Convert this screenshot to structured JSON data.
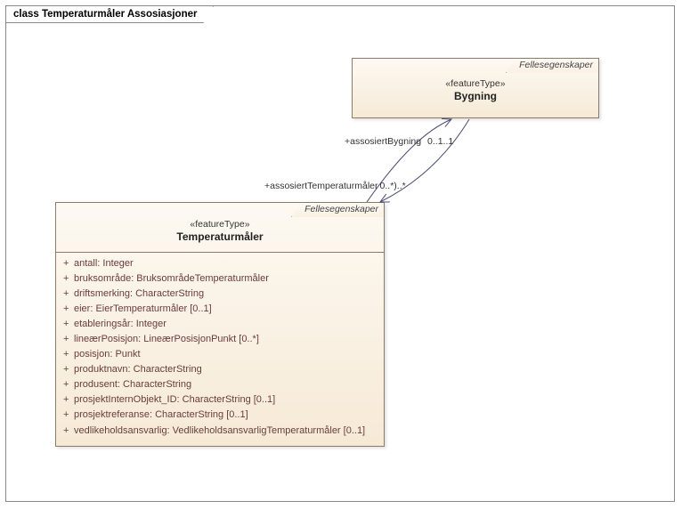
{
  "frame": {
    "title": "class Temperaturmåler Assosiasjoner"
  },
  "bygning": {
    "package": "Fellesegenskaper",
    "stereotype": "«featureType»",
    "name": "Bygning"
  },
  "temperaturmaler": {
    "package": "Fellesegenskaper",
    "stereotype": "«featureType»",
    "name": "Temperaturmåler",
    "attrs": [
      {
        "vis": "+",
        "text": "antall: Integer"
      },
      {
        "vis": "+",
        "text": "bruksområde: BruksområdeTemperaturmåler"
      },
      {
        "vis": "+",
        "text": "driftsmerking: CharacterString"
      },
      {
        "vis": "+",
        "text": "eier: EierTemperaturmåler [0..1]"
      },
      {
        "vis": "+",
        "text": "etableringsår: Integer"
      },
      {
        "vis": "+",
        "text": "lineærPosisjon: LineærPosisjonPunkt [0..*]"
      },
      {
        "vis": "+",
        "text": "posisjon: Punkt"
      },
      {
        "vis": "+",
        "text": "produktnavn: CharacterString"
      },
      {
        "vis": "+",
        "text": "produsent: CharacterString"
      },
      {
        "vis": "+",
        "text": "prosjektInternObjekt_ID: CharacterString [0..1]"
      },
      {
        "vis": "+",
        "text": "prosjektreferanse: CharacterString [0..1]"
      },
      {
        "vis": "+",
        "text": "vedlikeholdsansvarlig: VedlikeholdsansvarligTemperaturmåler [0..1]"
      }
    ]
  },
  "assoc": {
    "role_top": "+assosiertBygning",
    "mult_top": "0..1",
    "dup_top": "..1",
    "role_bottom": "+assosiertTemperaturmåler",
    "mult_bottom": "0..*",
    "dup_bottom": ")..*"
  },
  "chart_data": {
    "type": "diagram",
    "title": "class Temperaturmåler Assosiasjoner",
    "notation": "UML Class Diagram",
    "classes": [
      {
        "name": "Bygning",
        "stereotype": "featureType",
        "package": "Fellesegenskaper",
        "attributes": []
      },
      {
        "name": "Temperaturmåler",
        "stereotype": "featureType",
        "package": "Fellesegenskaper",
        "attributes": [
          {
            "visibility": "+",
            "name": "antall",
            "type": "Integer"
          },
          {
            "visibility": "+",
            "name": "bruksområde",
            "type": "BruksområdeTemperaturmåler"
          },
          {
            "visibility": "+",
            "name": "driftsmerking",
            "type": "CharacterString"
          },
          {
            "visibility": "+",
            "name": "eier",
            "type": "EierTemperaturmåler",
            "multiplicity": "0..1"
          },
          {
            "visibility": "+",
            "name": "etableringsår",
            "type": "Integer"
          },
          {
            "visibility": "+",
            "name": "lineærPosisjon",
            "type": "LineærPosisjonPunkt",
            "multiplicity": "0..*"
          },
          {
            "visibility": "+",
            "name": "posisjon",
            "type": "Punkt"
          },
          {
            "visibility": "+",
            "name": "produktnavn",
            "type": "CharacterString"
          },
          {
            "visibility": "+",
            "name": "produsent",
            "type": "CharacterString"
          },
          {
            "visibility": "+",
            "name": "prosjektInternObjekt_ID",
            "type": "CharacterString",
            "multiplicity": "0..1"
          },
          {
            "visibility": "+",
            "name": "prosjektreferanse",
            "type": "CharacterString",
            "multiplicity": "0..1"
          },
          {
            "visibility": "+",
            "name": "vedlikeholdsansvarlig",
            "type": "VedlikeholdsansvarligTemperaturmåler",
            "multiplicity": "0..1"
          }
        ]
      }
    ],
    "associations": [
      {
        "end1": {
          "class": "Bygning",
          "role": "assosiertBygning",
          "multiplicity": "0..1",
          "navigable": true
        },
        "end2": {
          "class": "Temperaturmåler",
          "role": "assosiertTemperaturmåler",
          "multiplicity": "0..*",
          "navigable": true
        }
      }
    ]
  }
}
